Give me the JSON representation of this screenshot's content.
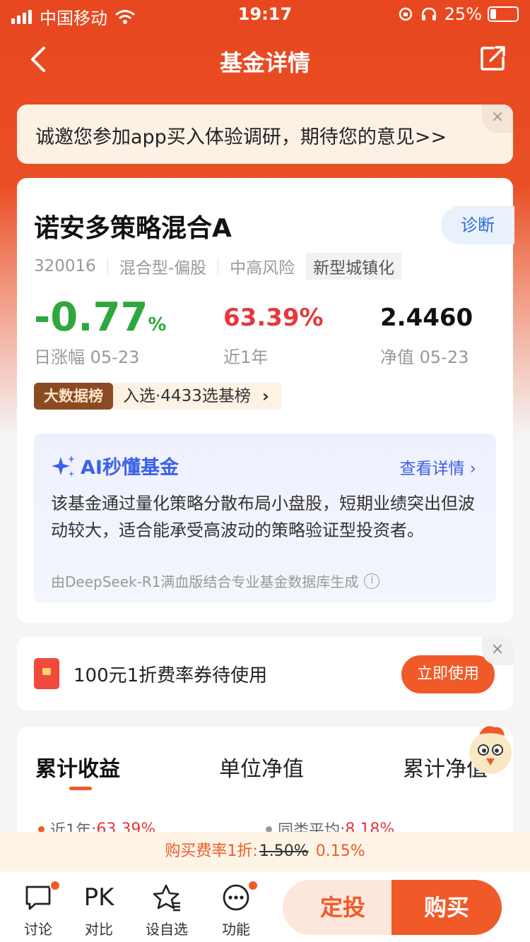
{
  "status": {
    "carrier": "中国移动",
    "time": "19:17",
    "battery": "25%"
  },
  "nav": {
    "title": "基金详情"
  },
  "invite": {
    "text": "诚邀您参加app买入体验调研，期待您的意见>>",
    "close": "×"
  },
  "fund": {
    "name": "诺安多策略混合A",
    "diagnose": "诊断",
    "code": "320016",
    "type": "混合型-偏股",
    "risk": "中高风险",
    "theme": "新型城镇化",
    "daily_change": "-0.77",
    "daily_change_unit": "%",
    "daily_change_label": "日涨幅 05-23",
    "year_return": "63.39%",
    "year_return_label": "近1年",
    "nav_value": "2.4460",
    "nav_label": "净值 05-23",
    "rank_badge": "大数据榜",
    "rank_text": "入选·4433选基榜",
    "rank_chevron": "›"
  },
  "ai": {
    "title": "AI秒懂基金",
    "more": "查看详情 ›",
    "summary": "该基金通过量化策略分散布局小盘股，短期业绩突出但波动较大，适合能承受高波动的策略验证型投资者。",
    "footnote": "由DeepSeek-R1满血版结合专业基金数据库生成",
    "info_icon": "i"
  },
  "coupon": {
    "text": "100元1折费率券待使用",
    "button": "立即使用",
    "close": "×"
  },
  "chart_tabs": {
    "tab1": "累计收益",
    "tab2": "单位净值",
    "tab3": "累计净值",
    "legend1_label": "近1年:",
    "legend1_value": "63.39%",
    "legend2_label": "同类平均:",
    "legend2_value": "8.18%"
  },
  "fee": {
    "label": "购买费率1折:",
    "old": "1.50%",
    "new": "0.15%"
  },
  "bottom": {
    "discuss": "讨论",
    "compare_icon": "PK",
    "compare": "对比",
    "watchlist": "设自选",
    "functions": "功能",
    "dingtou": "定投",
    "buy": "购买"
  },
  "colors": {
    "brand": "#f05a28",
    "header": "#e8471f",
    "down": "#2ea83e",
    "up": "#e4393c",
    "ai_blue": "#3b62e6"
  }
}
